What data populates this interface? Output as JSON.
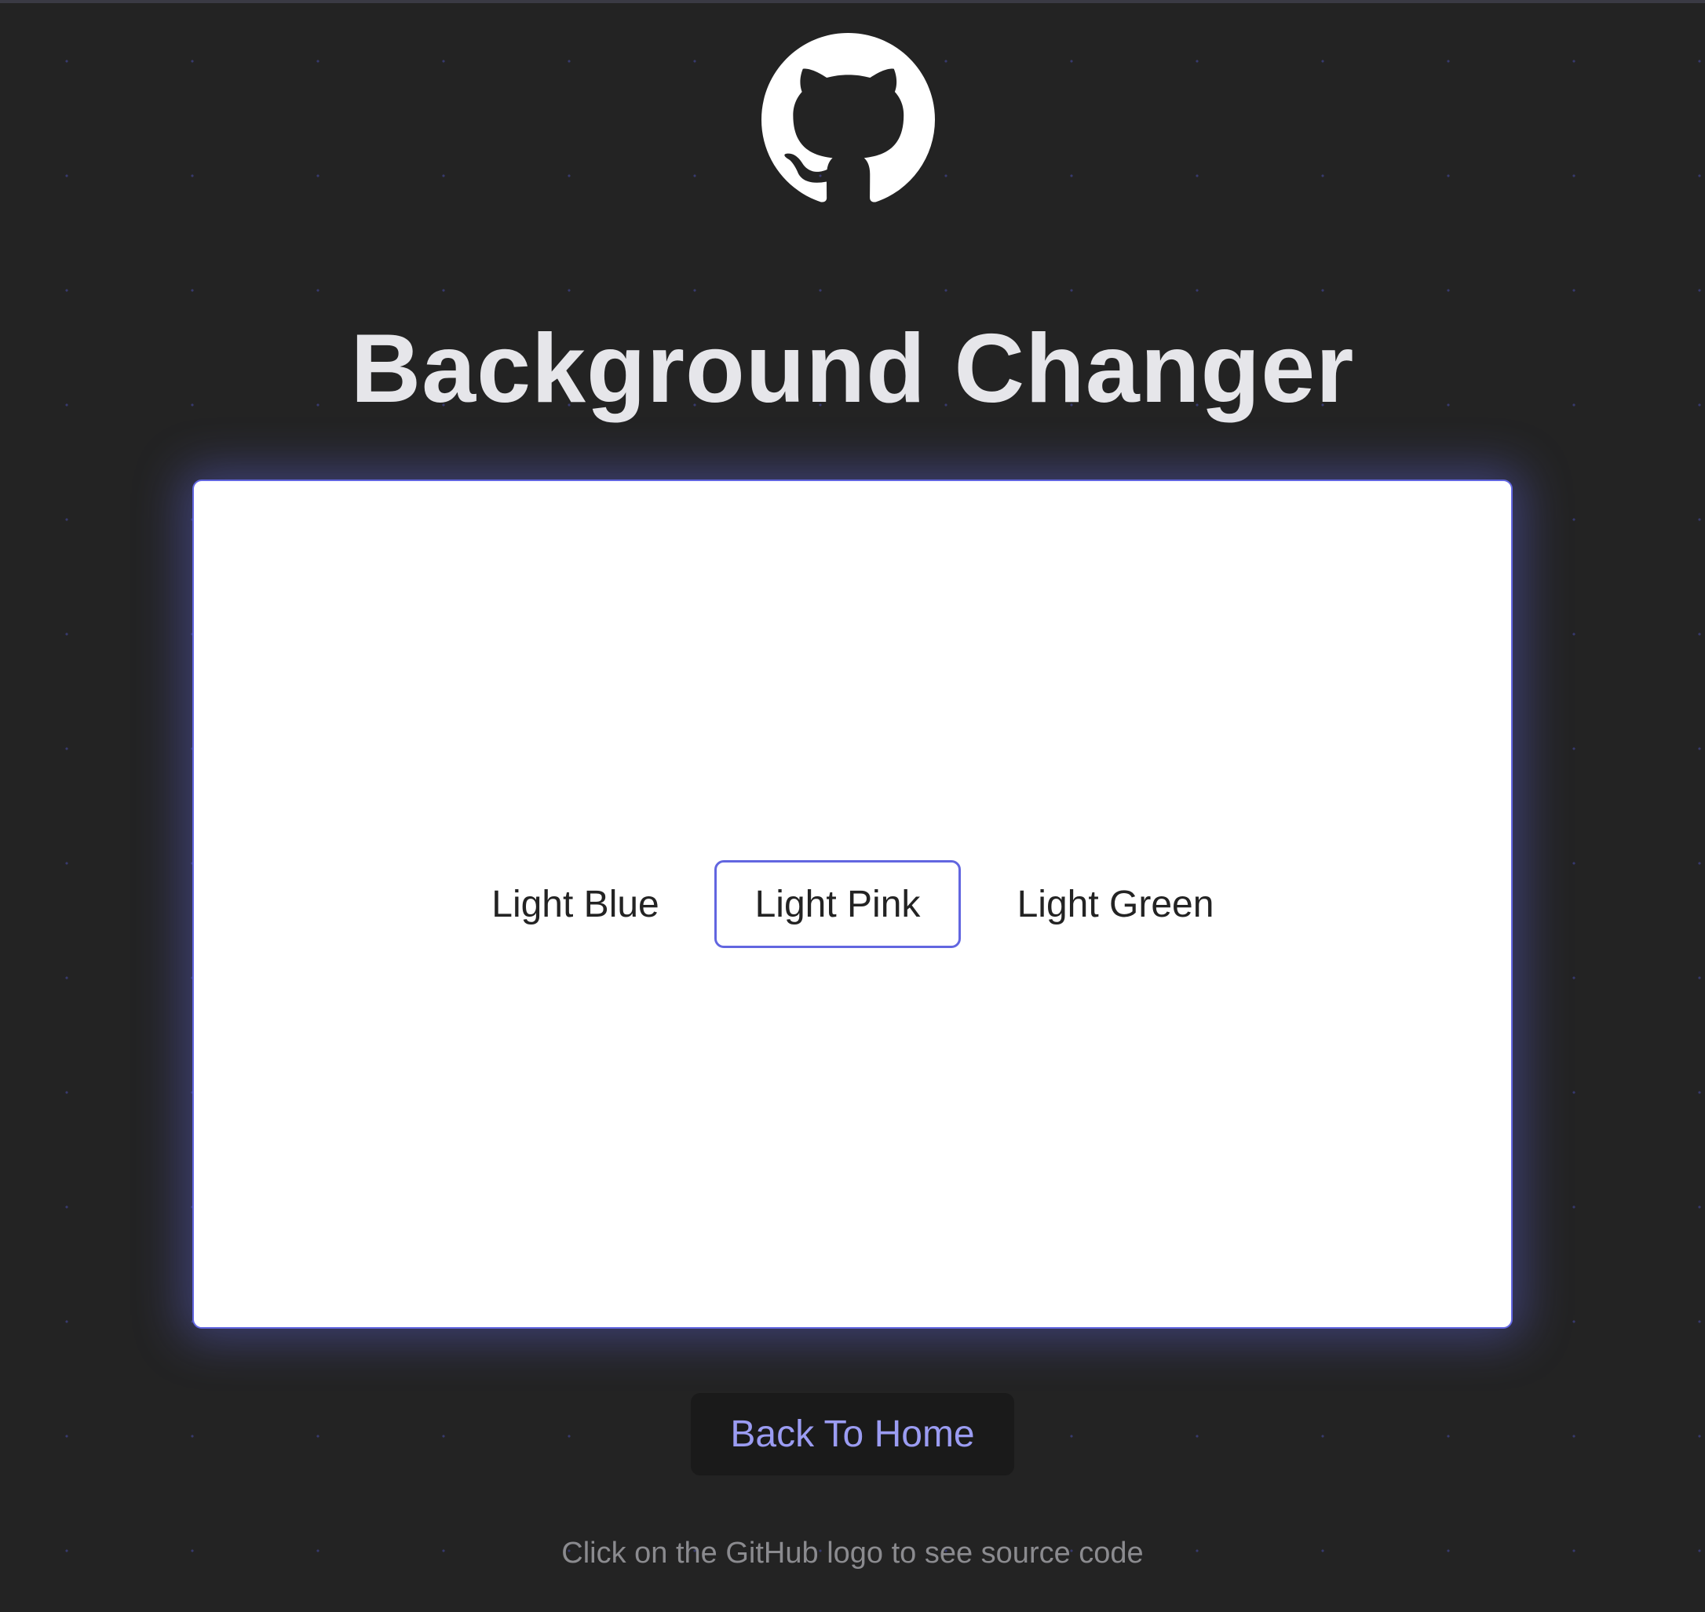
{
  "page": {
    "background_color": "#232323",
    "dot_color": "#5055c8"
  },
  "logo": {
    "icon": "github-logo-icon",
    "color": "#ffffff"
  },
  "header": {
    "title": "Background Changer"
  },
  "card": {
    "background_color": "#ffffff",
    "border_color": "#6266e0",
    "buttons": [
      {
        "label": "Light Blue",
        "selected": false
      },
      {
        "label": "Light Pink",
        "selected": true
      },
      {
        "label": "Light Green",
        "selected": false
      }
    ]
  },
  "back_button": {
    "label": "Back To Home",
    "text_color": "#9b9cf2"
  },
  "footer": {
    "note": "Click on the GitHub logo to see source code"
  }
}
